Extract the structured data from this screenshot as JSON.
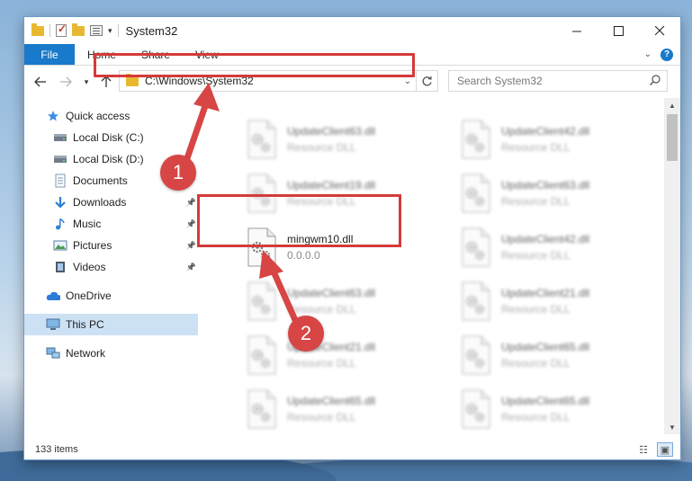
{
  "window": {
    "title": "System32"
  },
  "ribbon": {
    "tabs": [
      "File",
      "Home",
      "Share",
      "View"
    ]
  },
  "address_bar": {
    "path": "C:\\Windows\\System32"
  },
  "search": {
    "placeholder": "Search System32"
  },
  "sidebar": {
    "items": [
      {
        "label": "Quick access",
        "icon": "star-icon",
        "pinned": false
      },
      {
        "label": "Local Disk (C:)",
        "icon": "drive-icon",
        "pinned": false
      },
      {
        "label": "Local Disk (D:)",
        "icon": "drive-icon",
        "pinned": false
      },
      {
        "label": "Documents",
        "icon": "documents-icon",
        "pinned": true
      },
      {
        "label": "Downloads",
        "icon": "download-icon",
        "pinned": true
      },
      {
        "label": "Music",
        "icon": "music-icon",
        "pinned": true
      },
      {
        "label": "Pictures",
        "icon": "pictures-icon",
        "pinned": true
      },
      {
        "label": "Videos",
        "icon": "videos-icon",
        "pinned": true
      },
      {
        "label": "OneDrive",
        "icon": "cloud-icon",
        "pinned": false
      },
      {
        "label": "This PC",
        "icon": "computer-icon",
        "pinned": false,
        "selected": true
      },
      {
        "label": "Network",
        "icon": "network-icon",
        "pinned": false
      }
    ]
  },
  "files": {
    "left": [
      {
        "name": "UpdateClient63.dll",
        "type": "Resource DLL",
        "blurred": true
      },
      {
        "name": "UpdateClient19.dll",
        "type": "Resource DLL",
        "blurred": true
      },
      {
        "name": "mingwm10.dll",
        "type": "0.0.0.0",
        "blurred": false
      },
      {
        "name": "UpdateClient63.dll",
        "type": "Resource DLL",
        "blurred": true
      },
      {
        "name": "UpdateClient21.dll",
        "type": "Resource DLL",
        "blurred": true
      },
      {
        "name": "UpdateClient65.dll",
        "type": "Resource DLL",
        "blurred": true
      }
    ],
    "right": [
      {
        "name": "UpdateClient42.dll",
        "type": "Resource DLL",
        "blurred": true
      },
      {
        "name": "UpdateClient63.dll",
        "type": "Resource DLL",
        "blurred": true
      },
      {
        "name": "UpdateClient42.dll",
        "type": "Resource DLL",
        "blurred": true
      },
      {
        "name": "UpdateClient21.dll",
        "type": "Resource DLL",
        "blurred": true
      },
      {
        "name": "UpdateClient65.dll",
        "type": "Resource DLL",
        "blurred": true
      },
      {
        "name": "UpdateClient65.dll",
        "type": "Resource DLL",
        "blurred": true
      }
    ]
  },
  "status": {
    "item_count": "133 items"
  },
  "annotations": {
    "step1": "1",
    "step2": "2",
    "color": "#d53a3a"
  },
  "colors": {
    "accent": "#1979ca",
    "selection": "#cde1f4",
    "highlight": "#d53a3a"
  }
}
